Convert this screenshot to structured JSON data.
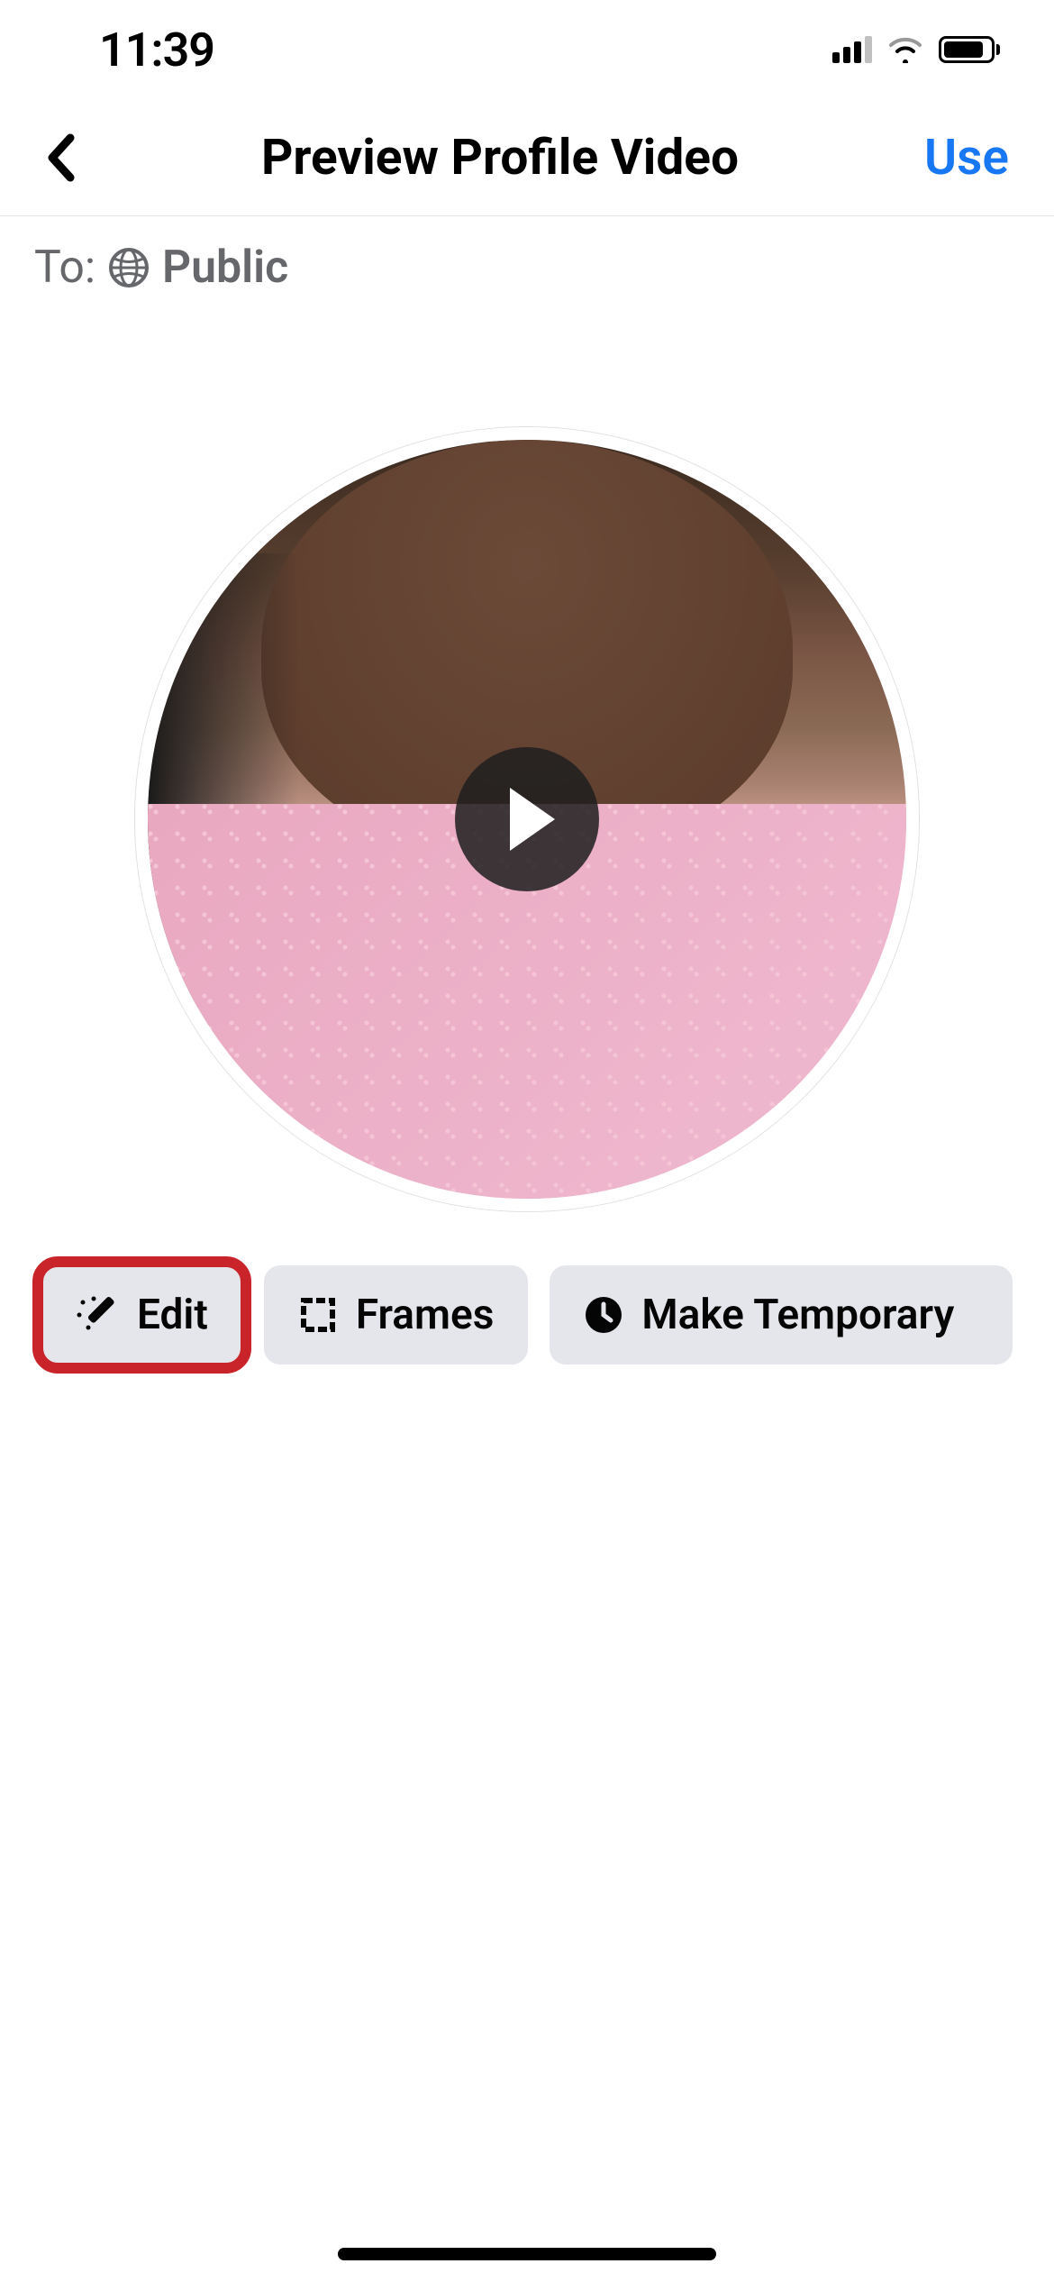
{
  "status": {
    "time": "11:39"
  },
  "nav": {
    "title": "Preview Profile Video",
    "use_label": "Use"
  },
  "audience": {
    "label": "To:",
    "value": "Public"
  },
  "actions": {
    "edit": "Edit",
    "frames": "Frames",
    "make_temporary": "Make Temporary"
  }
}
